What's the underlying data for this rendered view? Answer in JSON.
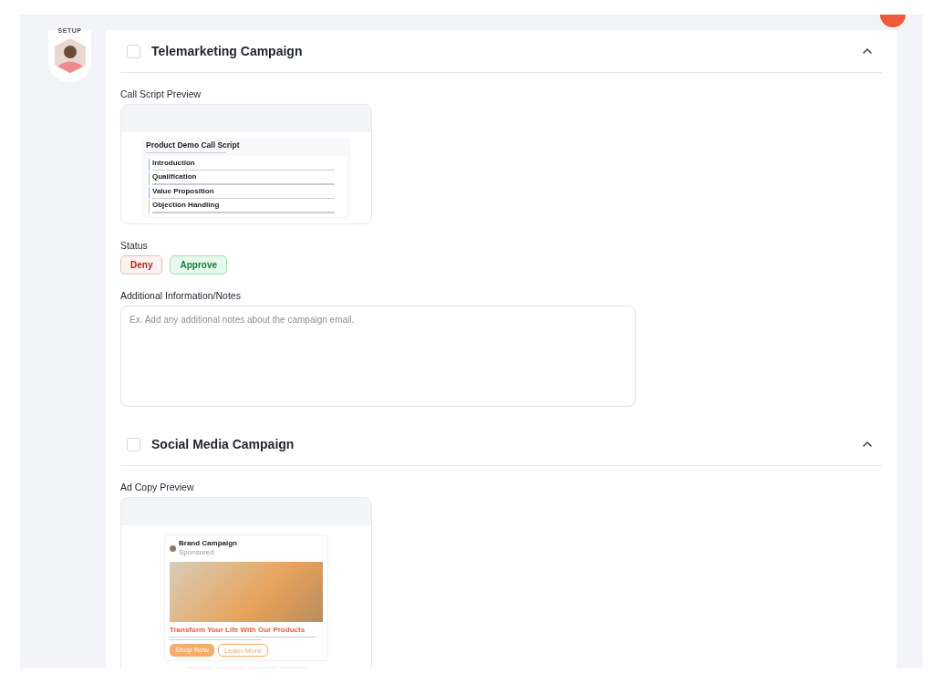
{
  "sidebar": {
    "label": "SETUP"
  },
  "campaigns": [
    {
      "title": "Telemarketing Campaign",
      "checked": false,
      "expanded": true,
      "preview_label": "Call Script Preview",
      "preview": {
        "kind": "script",
        "title": "Product Demo Call Script",
        "sections": [
          {
            "heading": "Introduction",
            "color": "#93a5f5"
          },
          {
            "heading": "Qualification",
            "color": "#8fd19e"
          },
          {
            "heading": "Value Proposition",
            "color": "#b79cf5"
          },
          {
            "heading": "Objection Handling",
            "color": "#f5b27f"
          }
        ]
      },
      "status": {
        "label": "Status",
        "options": [
          {
            "label": "Deny",
            "kind": "deny"
          },
          {
            "label": "Approve",
            "kind": "approve"
          }
        ]
      },
      "notes": {
        "label": "Additional Information/Notes",
        "placeholder": "Ex. Add any additional notes about the campaign email."
      }
    },
    {
      "title": "Social Media Campaign",
      "checked": false,
      "expanded": true,
      "preview_label": "Ad Copy Preview",
      "preview": {
        "kind": "ad",
        "brand": "Brand Campaign",
        "sponsored": "Sponsored",
        "headline": "Transform Your Life With Our Products",
        "buttons": [
          "Shop Now",
          "Learn More"
        ]
      }
    }
  ]
}
